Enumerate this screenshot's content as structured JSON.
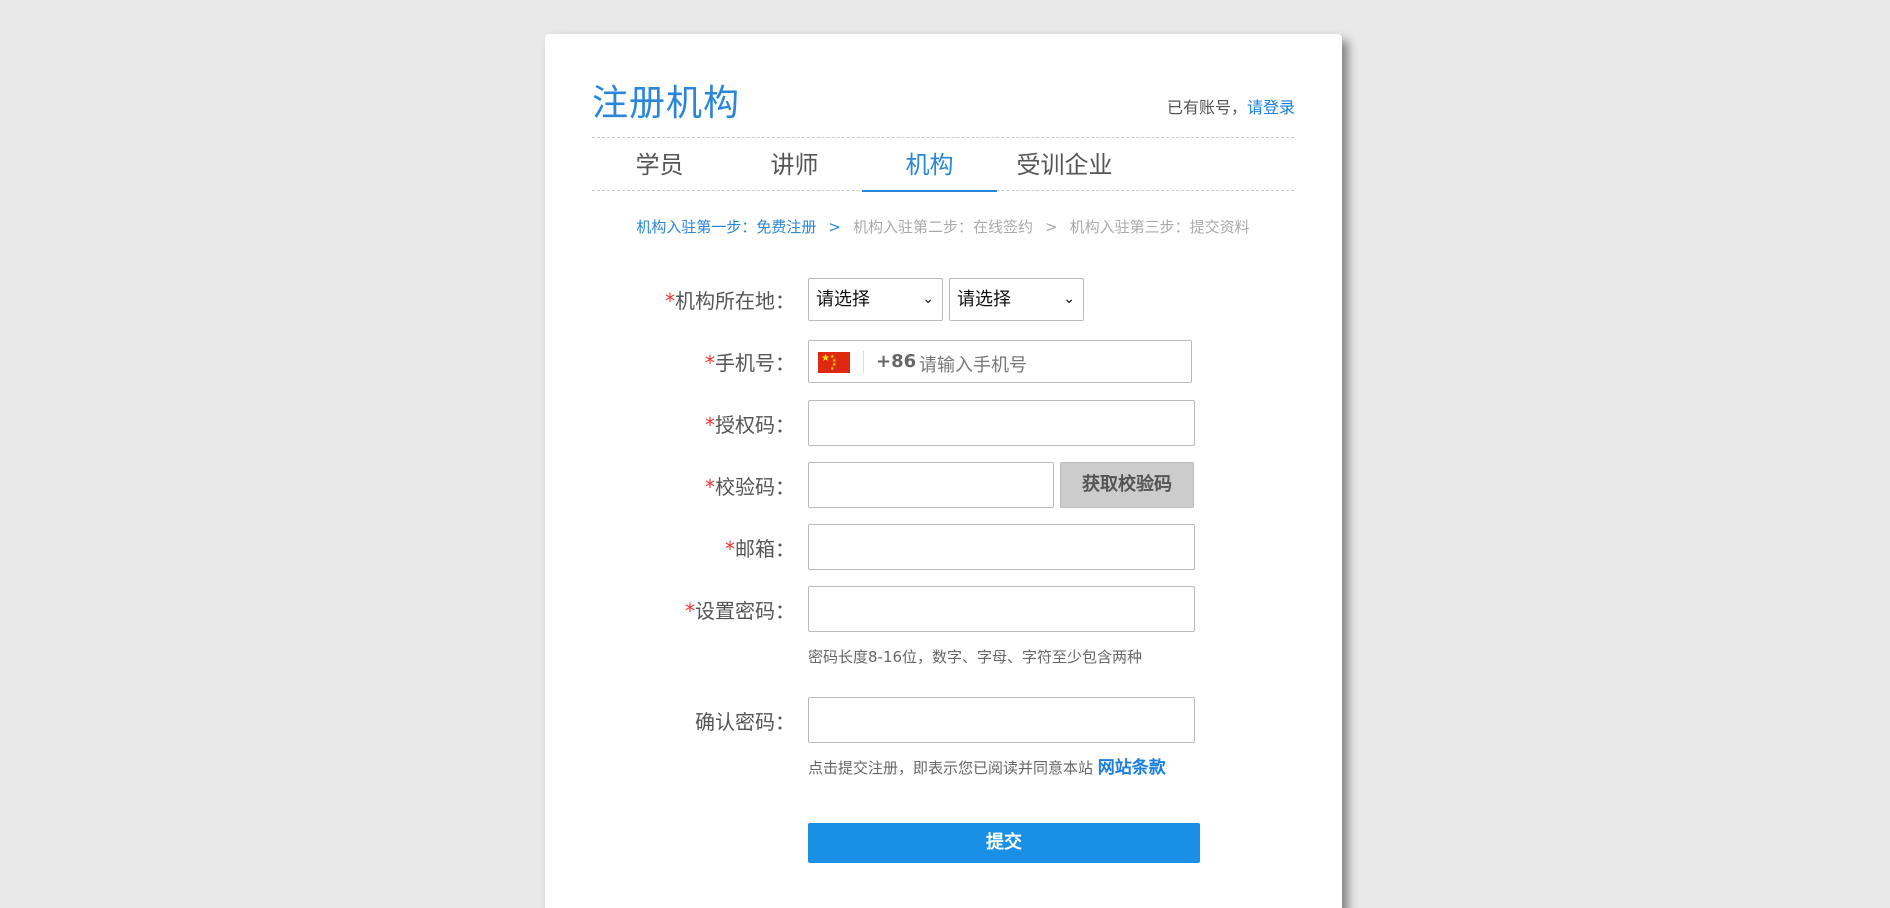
{
  "header": {
    "title": "注册机构",
    "login_prefix": "已有账号，",
    "login_link": "请登录"
  },
  "tabs": [
    {
      "label": "学员",
      "active": false
    },
    {
      "label": "讲师",
      "active": false
    },
    {
      "label": "机构",
      "active": true
    },
    {
      "label": "受训企业",
      "active": false
    }
  ],
  "steps": {
    "step1": "机构入驻第一步：免费注册",
    "step2": "机构入驻第二步：在线签约",
    "step3": "机构入驻第三步：提交资料",
    "arrow": ">"
  },
  "form": {
    "required_mark": "*",
    "location": {
      "label": "机构所在地：",
      "province": "请选择",
      "city": "请选择"
    },
    "phone": {
      "label": "手机号：",
      "country_code": "+86",
      "placeholder": "请输入手机号"
    },
    "auth_code": {
      "label": "授权码："
    },
    "verify_code": {
      "label": "校验码：",
      "button": "获取校验码"
    },
    "email": {
      "label": "邮箱："
    },
    "password": {
      "label": "设置密码：",
      "hint": "密码长度8-16位，数字、字母、字符至少包含两种"
    },
    "confirm_password": {
      "label": "确认密码："
    },
    "terms": {
      "text": "点击提交注册，即表示您已阅读并同意本站 ",
      "link": "网站条款"
    },
    "submit": "提交"
  },
  "colors": {
    "accent": "#2a86d9",
    "required": "#e33333",
    "button": "#1a8fe6"
  }
}
